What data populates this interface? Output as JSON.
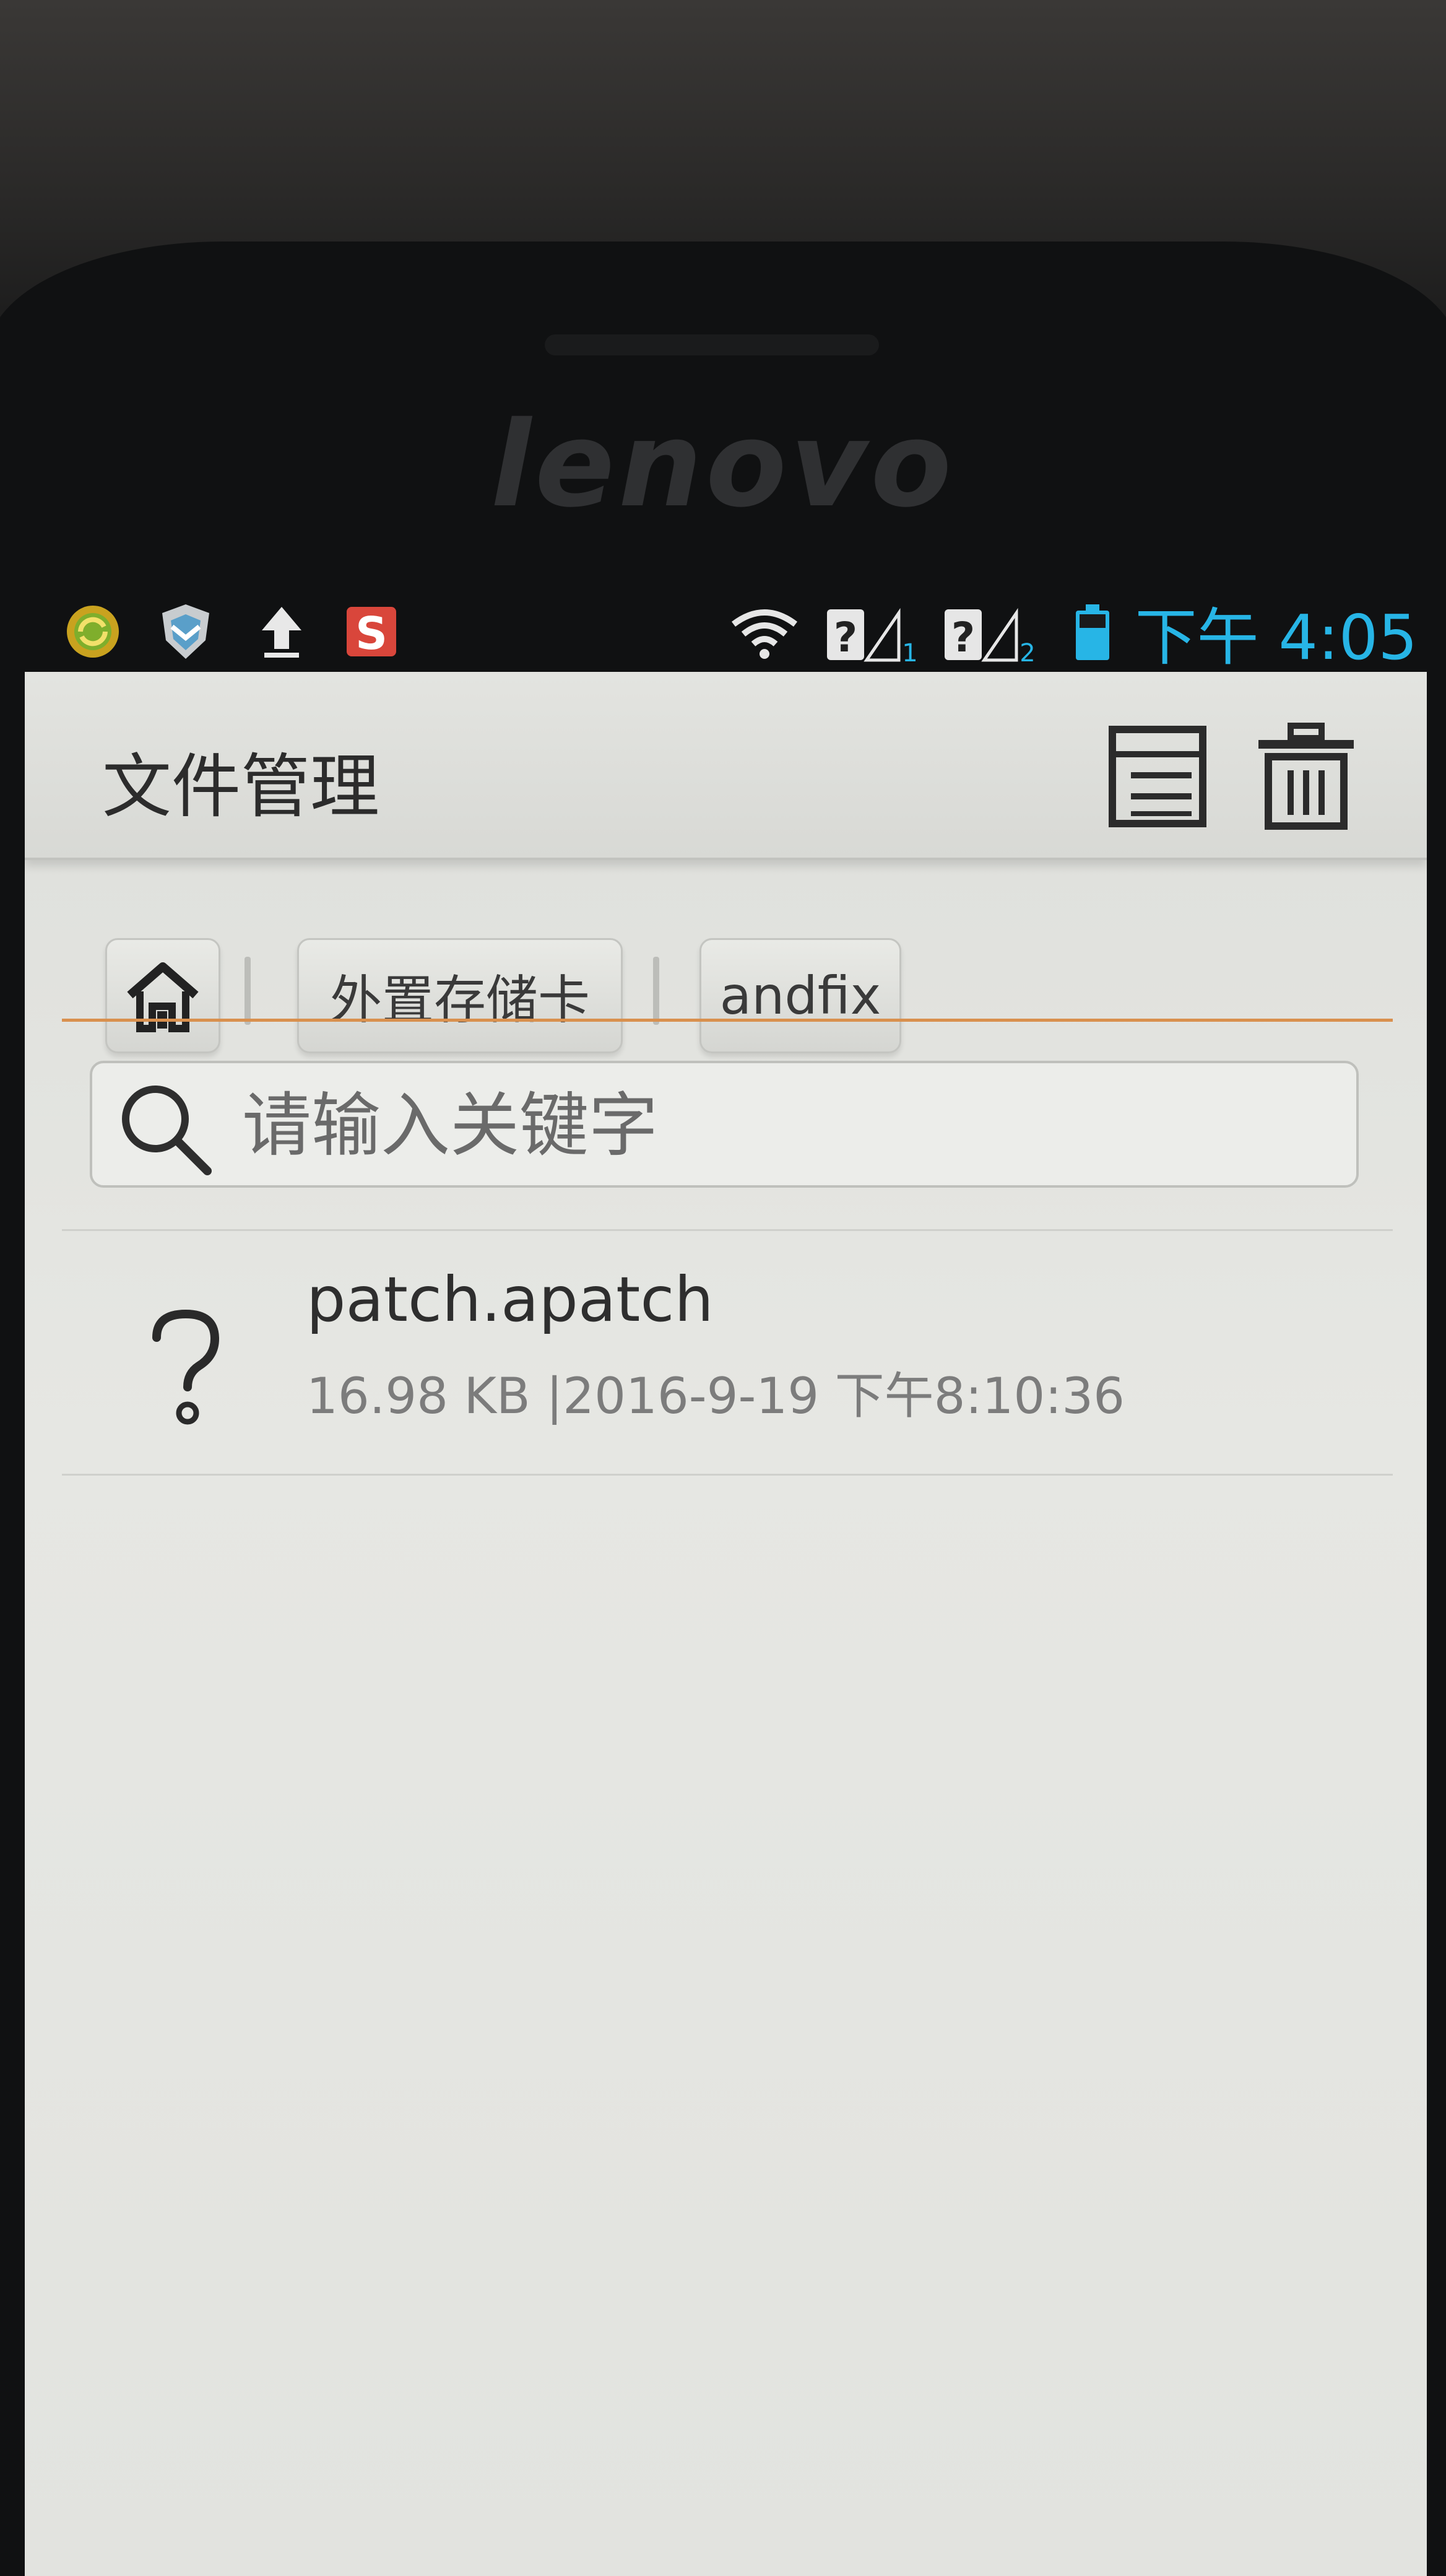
{
  "device": {
    "brand_logo": "lenovo"
  },
  "status_bar": {
    "time": "下午 4:05",
    "icons": [
      "sync-app-icon",
      "shield-app-icon",
      "upload-icon",
      "s-app-icon",
      "wifi-icon",
      "sim1-unknown-signal-icon",
      "sim2-unknown-signal-icon",
      "battery-icon"
    ],
    "sim1_label": "1",
    "sim2_label": "2",
    "sim_unknown": "?",
    "s_app_letter": "S"
  },
  "action_bar": {
    "title": "文件管理",
    "buttons": [
      "list-view-icon",
      "delete-icon"
    ]
  },
  "breadcrumb": {
    "items": [
      {
        "label": "",
        "icon": "home-icon"
      },
      {
        "label": "外置存储卡"
      },
      {
        "label": "andfix"
      }
    ]
  },
  "search": {
    "placeholder": "请输入关键字",
    "value": ""
  },
  "files": [
    {
      "name": "patch.apatch",
      "meta": "16.98 KB |2016-9-19 下午8:10:36",
      "icon": "unknown-file-icon"
    }
  ],
  "colors": {
    "status_time": "#27b5e6",
    "accent_line": "#d9904e",
    "screen_bg": "#e2e3df",
    "s_app": "#d9463b"
  }
}
